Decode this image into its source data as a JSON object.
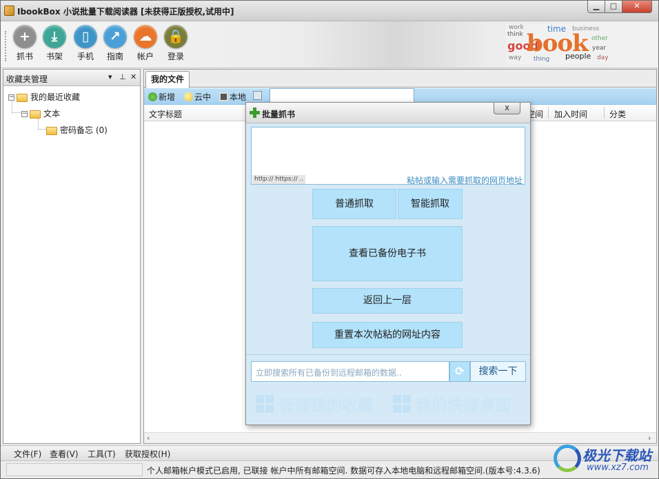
{
  "window": {
    "title": "IbookBox 小说批量下载阅读器 [未获得正版授权,试用中]",
    "min_glyph": "▁",
    "max_glyph": "□",
    "close_glyph": "✕"
  },
  "toolbar": {
    "items": [
      {
        "label": "抓书",
        "icon": "plus-icon",
        "glyph": "+",
        "color": "#8e8e8e"
      },
      {
        "label": "书架",
        "icon": "download-icon",
        "glyph": "⤓",
        "color": "#3fa596"
      },
      {
        "label": "手机",
        "icon": "phone-icon",
        "glyph": "▯",
        "color": "#3f95c8"
      },
      {
        "label": "指南",
        "icon": "chart-icon",
        "glyph": "↗",
        "color": "#4aa0d6"
      },
      {
        "label": "帐户",
        "icon": "cloud-icon",
        "glyph": "☁",
        "color": "#e8752a"
      },
      {
        "label": "登录",
        "icon": "lock-icon",
        "glyph": "🔒",
        "color": "#7a7c3a"
      }
    ],
    "logo": {
      "big": "book",
      "good": "good",
      "words": [
        "think",
        "time",
        "people",
        "business",
        "other",
        "year",
        "way",
        "thing",
        "day",
        "work"
      ]
    }
  },
  "left_panel": {
    "title": "收藏夹管理",
    "dropdown_glyph": "▾",
    "pin_glyph": "⊥",
    "close_glyph": "✕",
    "tree": {
      "root": "我的最近收藏",
      "child": "文本",
      "leaf": "密码备忘 (0)"
    }
  },
  "right_panel": {
    "tab": "我的文件",
    "subbar": {
      "add": "新增",
      "cloud": "云中",
      "local": "本地",
      "search_value": ""
    },
    "columns": {
      "title": "文字标题",
      "space": "空间",
      "added": "加入时间",
      "category": "分类"
    },
    "scroll_left": "‹",
    "scroll_right": "›"
  },
  "dialog": {
    "title": "批量抓书",
    "close_glyph": "x",
    "textarea_tag": "http:// https:// ..",
    "textarea_hint": "粘帖或输入需要抓取的网页地址",
    "btn_normal": "普通抓取",
    "btn_smart": "智能抓取",
    "btn_view_backup": "查看已备份电子书",
    "btn_back": "返回上一层",
    "btn_reset": "重置本次帖粘的网址内容",
    "search_placeholder": "立即搜索所有已备份到远程邮箱的数据..",
    "refresh_glyph": "⟳",
    "search_button": "搜索一下",
    "tile_manage": "管理我的收藏",
    "tile_desktop": "我的快捷桌面"
  },
  "menubar": {
    "items": [
      "文件(F)",
      "查看(V)",
      "工具(T)",
      "获取授权(H)"
    ]
  },
  "status": {
    "text": "个人邮箱帐户模式已启用, 已联接 帐户中所有邮箱空间. 数据可存入本地电脑和远程邮箱空间.(版本号:4.3.6)"
  },
  "watermark": {
    "main": "极光下载站",
    "sub": "www.xz7.com"
  }
}
